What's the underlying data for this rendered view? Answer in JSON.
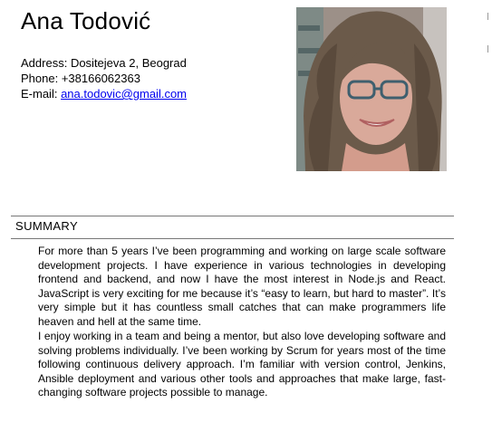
{
  "header": {
    "name": "Ana Todović",
    "address_label": "Address:",
    "address": "Dositejeva 2, Beograd",
    "phone_label": "Phone:",
    "phone": "+38166062363",
    "email_label": "E-mail:",
    "email": "ana.todovic@gmail.com"
  },
  "summary": {
    "title": "SUMMARY",
    "paragraphs": [
      "For more than 5 years I’ve been programming and working on large scale software development projects. I have experience in various technologies in developing frontend and backend, and now I have the most interest in Node.js and React. JavaScript is very exciting for me because it’s “easy to learn, but hard to master”. It’s very simple but it has countless small catches that can make programmers life heaven and hell at the same time.",
      "I enjoy working in a team and being a mentor, but also love developing software and solving problems individually. I’ve been working by Scrum for years most of the time following continuous delivery approach. I’m familiar with version control, Jenkins, Ansible deployment and various other tools and approaches that make large, fast-changing software projects possible to manage."
    ]
  },
  "colors": {
    "link": "#0000ee",
    "rule": "#777777"
  }
}
